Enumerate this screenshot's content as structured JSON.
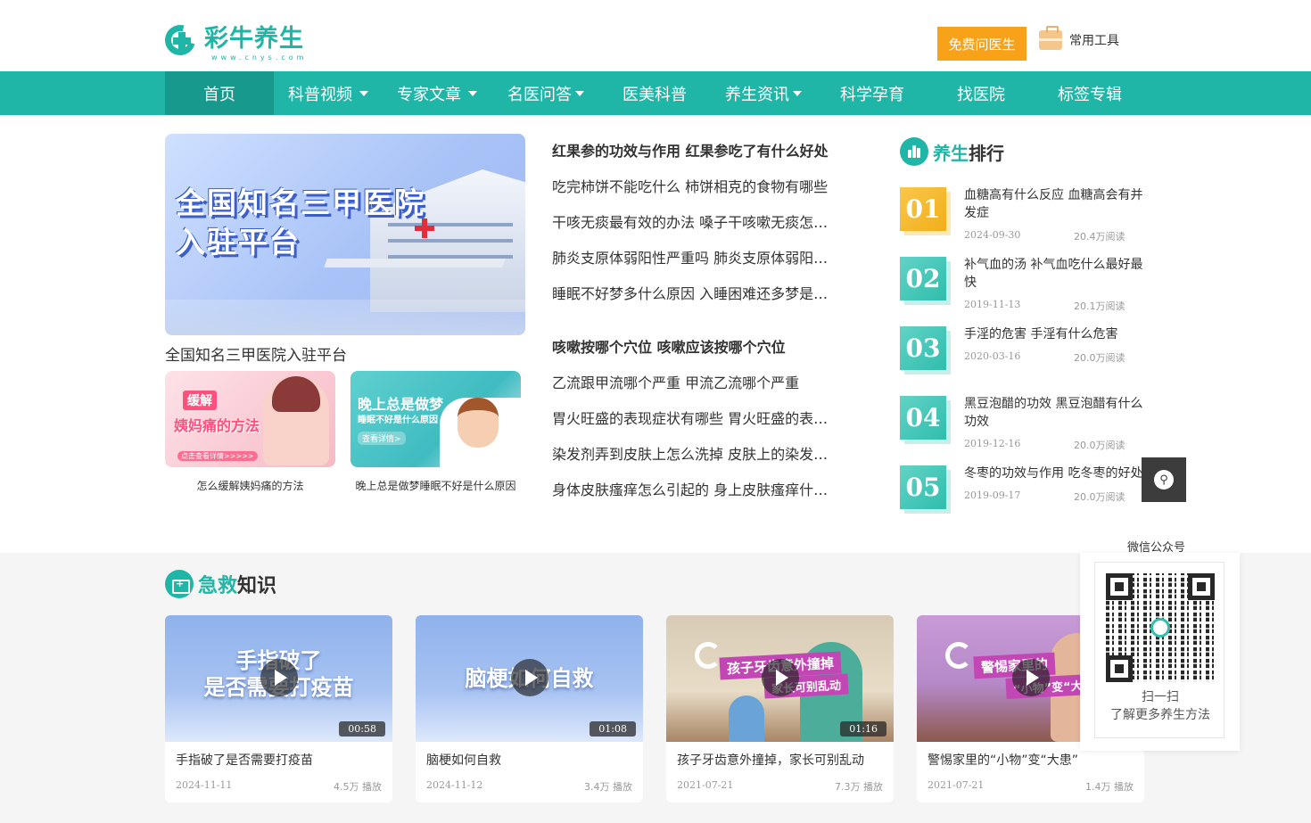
{
  "header": {
    "logo_name": "彩牛养生",
    "logo_sub": "www.cnys.com",
    "ask_button": "免费问医生",
    "tools_label": "常用工具"
  },
  "nav": {
    "items": [
      {
        "label": "首页",
        "active": true,
        "dropdown": false
      },
      {
        "label": "科普视频",
        "active": false,
        "dropdown": true
      },
      {
        "label": "专家文章",
        "active": false,
        "dropdown": true
      },
      {
        "label": "名医问答",
        "active": false,
        "dropdown": true
      },
      {
        "label": "医美科普",
        "active": false,
        "dropdown": false
      },
      {
        "label": "养生资讯",
        "active": false,
        "dropdown": true
      },
      {
        "label": "科学孕育",
        "active": false,
        "dropdown": false
      },
      {
        "label": "找医院",
        "active": false,
        "dropdown": false
      },
      {
        "label": "标签专辑",
        "active": false,
        "dropdown": false
      }
    ]
  },
  "banner": {
    "image_text_line1": "全国知名三甲医院",
    "image_text_line2": "入驻平台",
    "caption": "全国知名三甲医院入驻平台"
  },
  "thumbs": [
    {
      "tag": "缓解",
      "big": "姨妈痛的方法",
      "small": "点击查看详情>>>>>",
      "caption": "怎么缓解姨妈痛的方法"
    },
    {
      "t1": "晚上总是做梦",
      "t2": "睡眠不好是什么原因",
      "t3": "查看详情>",
      "caption": "晚上总是做梦睡眠不好是什么原因"
    }
  ],
  "articles": [
    {
      "title": "红果参的功效与作用 红果参吃了有什么好处",
      "bold": true
    },
    {
      "title": "吃完柿饼不能吃什么 柿饼相克的食物有哪些",
      "bold": false
    },
    {
      "title": "干咳无痰最有效的办法 嗓子干咳嗽无痰怎么办",
      "bold": false
    },
    {
      "title": "肺炎支原体弱阳性严重吗 肺炎支原体弱阳会传染吗",
      "bold": false
    },
    {
      "title": "睡眠不好梦多什么原因 入睡困难还多梦是什么原因",
      "bold": false
    },
    {
      "title": "咳嗽按哪个穴位 咳嗽应该按哪个穴位",
      "bold": true
    },
    {
      "title": "乙流跟甲流哪个严重 甲流乙流哪个严重",
      "bold": false
    },
    {
      "title": "胃火旺盛的表现症状有哪些 胃火旺盛的表现症状",
      "bold": false
    },
    {
      "title": "染发剂弄到皮肤上怎么洗掉 皮肤上的染发剂怎么去除",
      "bold": false
    },
    {
      "title": "身体皮肤瘙痒怎么引起的 身上皮肤瘙痒什么原因",
      "bold": false
    }
  ],
  "ranking": {
    "title_highlight": "养生",
    "title_rest": "排行",
    "items": [
      {
        "num": "01",
        "title": "血糖高有什么反应 血糖高会有并发症",
        "date": "2024-09-30",
        "reads": "20.4万阅读"
      },
      {
        "num": "02",
        "title": "补气血的汤 补气血吃什么最好最快",
        "date": "2019-11-13",
        "reads": "20.1万阅读"
      },
      {
        "num": "03",
        "title": "手淫的危害 手淫有什么危害",
        "date": "2020-03-16",
        "reads": "20.0万阅读"
      },
      {
        "num": "04",
        "title": "黑豆泡醋的功效 黑豆泡醋有什么功效",
        "date": "2019-12-16",
        "reads": "20.0万阅读"
      },
      {
        "num": "05",
        "title": "冬枣的功效与作用 吃冬枣的好处",
        "date": "2019-09-17",
        "reads": "20.0万阅读"
      }
    ]
  },
  "float": {
    "share_icon": "link-icon",
    "qr_label": "微信公众号",
    "qr_text1": "扫一扫",
    "qr_text2": "了解更多养生方法"
  },
  "first_aid": {
    "title_highlight": "急救",
    "title_rest": "知识",
    "videos": [
      {
        "thumb_text_line1": "手指破了",
        "thumb_text_line2": "是否需要打疫苗",
        "duration": "00:58",
        "title": "手指破了是否需要打疫苗",
        "date": "2024-11-11",
        "plays": "4.5万 播放"
      },
      {
        "thumb_text_line1": "脑梗如何自救",
        "duration": "01:08",
        "title": "脑梗如何自救",
        "date": "2024-11-12",
        "plays": "3.4万 播放"
      },
      {
        "ribbon_line1": "孩子牙齿意外撞掉",
        "ribbon_line2": "家长可别乱动",
        "duration": "01:16",
        "title": "孩子牙齿意外撞掉，家长可别乱动",
        "date": "2021-07-21",
        "plays": "7.3万 播放"
      },
      {
        "ribbon_line1": "警惕家里的",
        "ribbon_line2": "“小物”变“大患”",
        "duration": "",
        "title": "警惕家里的“小物”变“大患”",
        "date": "2021-07-21",
        "plays": "1.4万 播放"
      }
    ]
  },
  "colors": {
    "brand": "#1fb6a8",
    "accent": "#f8a21a"
  }
}
